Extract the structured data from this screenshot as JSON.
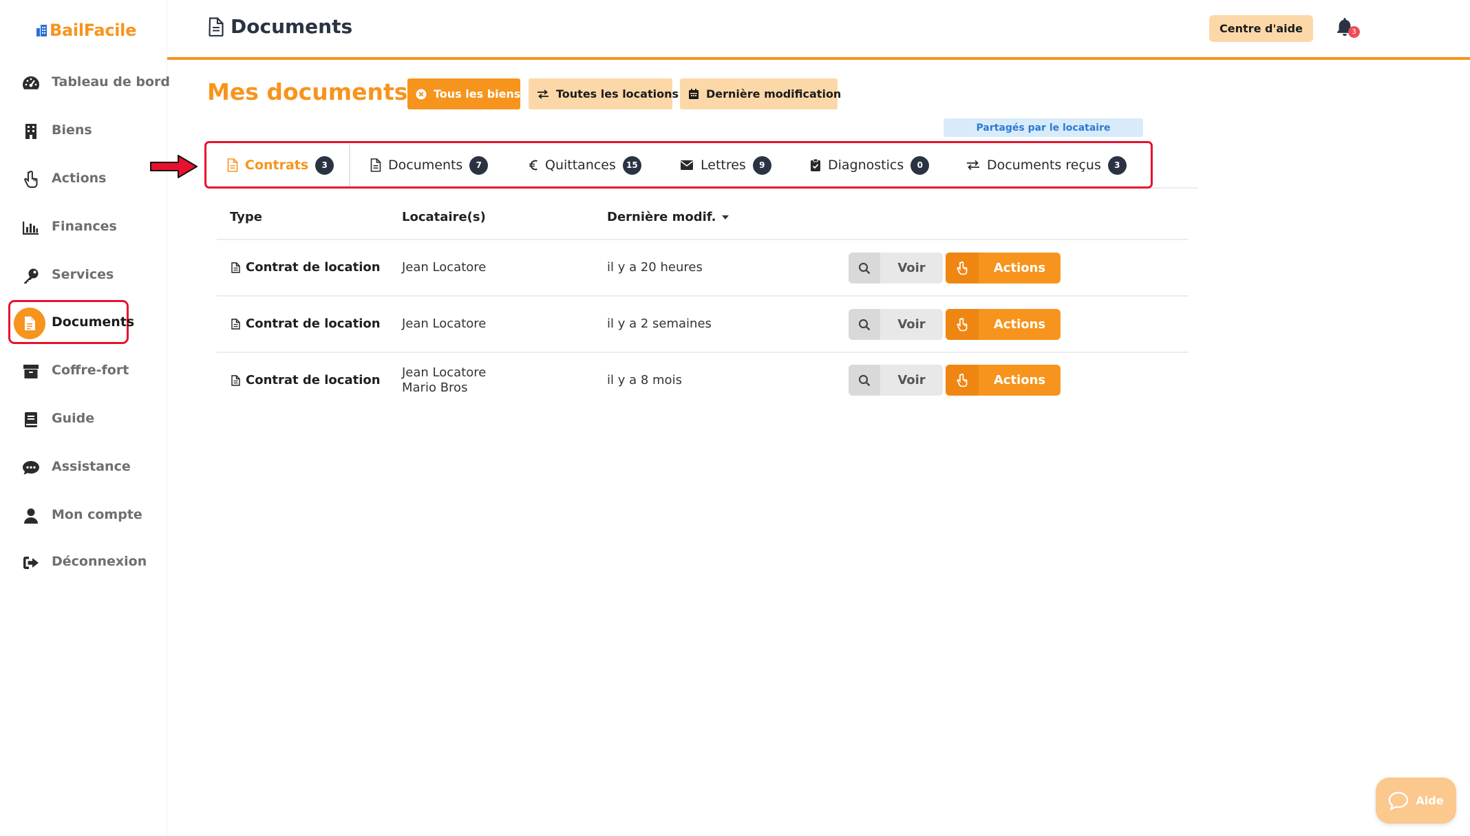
{
  "brand": {
    "name": "BailFacile",
    "color": "#f7941d"
  },
  "sidebar": {
    "items": [
      {
        "label": "Tableau de bord",
        "icon": "dashboard-icon"
      },
      {
        "label": "Biens",
        "icon": "building-icon"
      },
      {
        "label": "Actions",
        "icon": "hand-pointer-icon"
      },
      {
        "label": "Finances",
        "icon": "bar-chart-icon"
      },
      {
        "label": "Services",
        "icon": "key-icon"
      },
      {
        "label": "Documents",
        "icon": "document-icon",
        "active": true
      },
      {
        "label": "Coffre-fort",
        "icon": "archive-icon"
      },
      {
        "label": "Guide",
        "icon": "book-icon"
      },
      {
        "label": "Assistance",
        "icon": "chat-icon"
      },
      {
        "label": "Mon compte",
        "icon": "user-icon"
      },
      {
        "label": "Déconnexion",
        "icon": "logout-icon"
      }
    ]
  },
  "header": {
    "title": "Documents",
    "help_center": "Centre d'aide",
    "notifications_count": "3"
  },
  "page": {
    "heading": "Mes documents",
    "filters": [
      {
        "label": "Tous les biens",
        "icon": "close-circle-icon"
      },
      {
        "label": "Toutes les locations",
        "icon": "exchange-icon"
      },
      {
        "label": "Dernière modification",
        "icon": "calendar-icon"
      }
    ],
    "shared_label": "Partagés par le locataire"
  },
  "tabs": [
    {
      "label": "Contrats",
      "count": "3",
      "icon": "document-icon",
      "active": true
    },
    {
      "label": "Documents",
      "count": "7",
      "icon": "document-icon"
    },
    {
      "label": "Quittances",
      "count": "15",
      "icon": "euro-icon"
    },
    {
      "label": "Lettres",
      "count": "9",
      "icon": "envelope-icon"
    },
    {
      "label": "Diagnostics",
      "count": "0",
      "icon": "clipboard-check-icon"
    },
    {
      "label": "Documents reçus",
      "count": "3",
      "icon": "exchange-icon"
    }
  ],
  "table": {
    "columns": [
      "Type",
      "Locataire(s)",
      "Dernière modif."
    ],
    "rows": [
      {
        "type": "Contrat de location",
        "tenants": [
          "Jean Locatore"
        ],
        "modified": "il y a 20 heures"
      },
      {
        "type": "Contrat de location",
        "tenants": [
          "Jean Locatore"
        ],
        "modified": "il y a 2 semaines"
      },
      {
        "type": "Contrat de location",
        "tenants": [
          "Jean Locatore",
          "Mario Bros"
        ],
        "modified": "il y a 8 mois"
      }
    ],
    "view_label": "Voir",
    "actions_label": "Actions"
  },
  "help_widget": {
    "label": "Aide"
  },
  "colors": {
    "accent": "#f7941d",
    "accent_soft": "#fcd8a8",
    "highlight": "#e8112d",
    "dark": "#2a3342"
  }
}
